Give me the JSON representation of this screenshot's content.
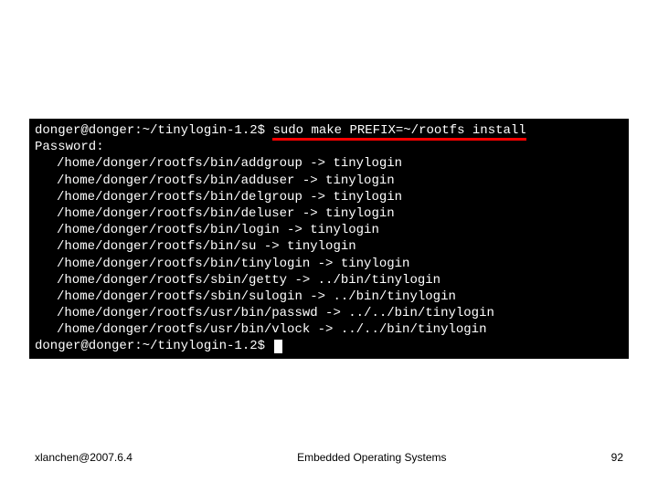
{
  "terminal": {
    "prompt1_prefix": "donger@donger:~/tinylogin-1.2$ ",
    "command": "sudo make PREFIX=~/rootfs install",
    "password_label": "Password:",
    "lines": [
      "/home/donger/rootfs/bin/addgroup -> tinylogin",
      "/home/donger/rootfs/bin/adduser -> tinylogin",
      "/home/donger/rootfs/bin/delgroup -> tinylogin",
      "/home/donger/rootfs/bin/deluser -> tinylogin",
      "/home/donger/rootfs/bin/login -> tinylogin",
      "/home/donger/rootfs/bin/su -> tinylogin",
      "/home/donger/rootfs/bin/tinylogin -> tinylogin",
      "/home/donger/rootfs/sbin/getty -> ../bin/tinylogin",
      "/home/donger/rootfs/sbin/sulogin -> ../bin/tinylogin",
      "/home/donger/rootfs/usr/bin/passwd -> ../../bin/tinylogin",
      "/home/donger/rootfs/usr/bin/vlock -> ../../bin/tinylogin"
    ],
    "prompt2": "donger@donger:~/tinylogin-1.2$ "
  },
  "footer": {
    "left": "xlanchen@2007.6.4",
    "center": "Embedded Operating Systems",
    "right": "92"
  }
}
